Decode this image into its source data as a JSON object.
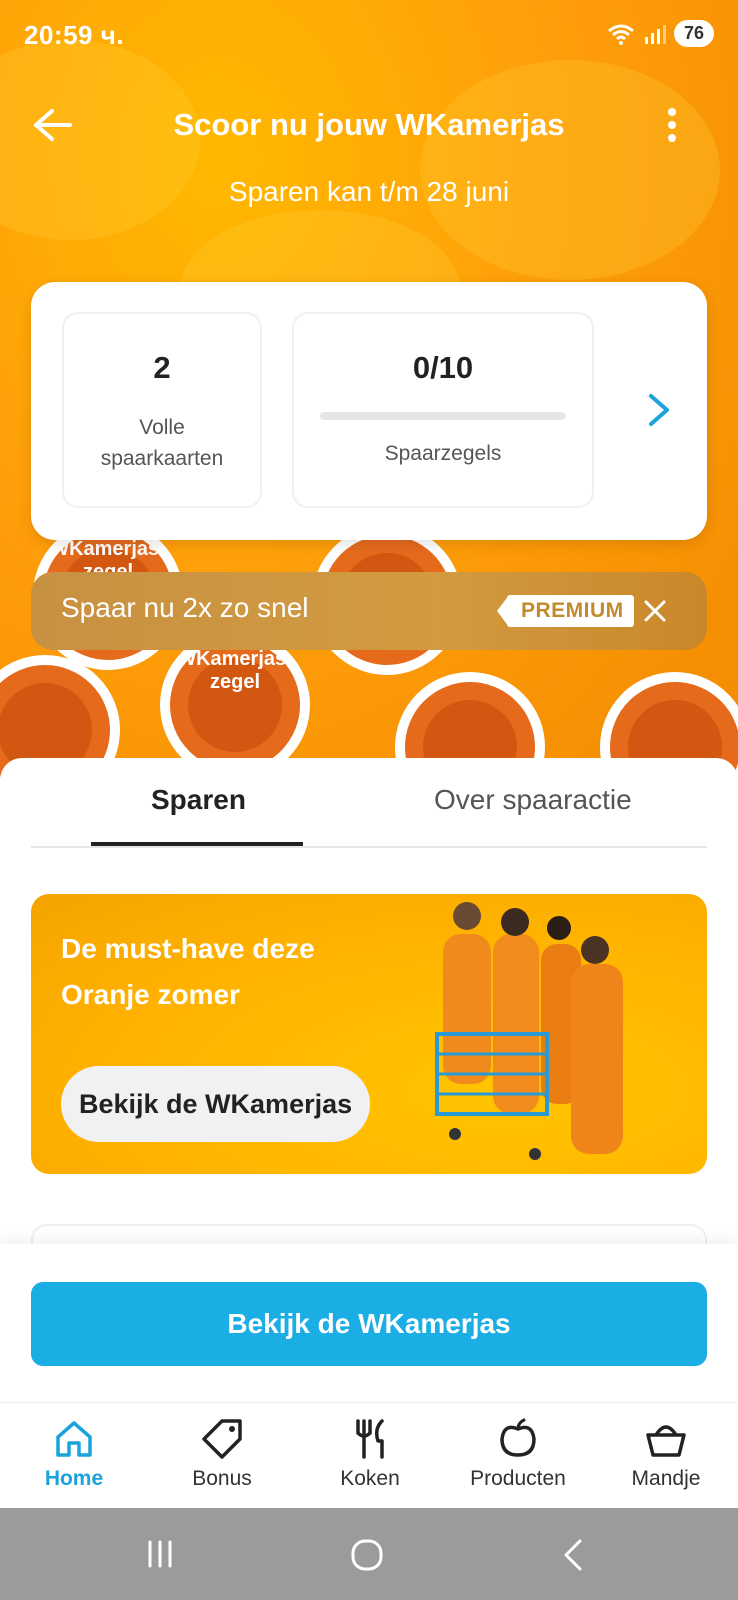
{
  "status_bar": {
    "time": "20:59 ч.",
    "battery": "76"
  },
  "header": {
    "title": "Scoor nu jouw WKamerjas",
    "subtitle": "Sparen kan t/m 28 juni"
  },
  "summary": {
    "full_cards_value": "2",
    "full_cards_label_1": "Volle",
    "full_cards_label_2": "spaarkaarten",
    "stamps_value": "0/10",
    "stamps_label": "Spaarzegels",
    "stamps_progress": 0
  },
  "stamp_art": {
    "text_a": "WKamerjas-zegel",
    "text_b": "WKamerjas-zegel"
  },
  "premium_banner": {
    "text": "Spaar nu 2x zo snel",
    "badge": "PREMIUM"
  },
  "tabs": [
    {
      "label": "Sparen",
      "active": true
    },
    {
      "label": "Over spaaractie",
      "active": false
    }
  ],
  "promo": {
    "title": "De must-have deze Oranje zomer",
    "button": "Bekijk de WKamerjas"
  },
  "cta": {
    "label": "Bekijk de WKamerjas"
  },
  "bottom_nav": [
    {
      "label": "Home",
      "icon": "home-icon",
      "active": true
    },
    {
      "label": "Bonus",
      "icon": "tag-icon",
      "active": false
    },
    {
      "label": "Koken",
      "icon": "cutlery-icon",
      "active": false
    },
    {
      "label": "Producten",
      "icon": "apple-icon",
      "active": false
    },
    {
      "label": "Mandje",
      "icon": "basket-icon",
      "active": false
    }
  ],
  "colors": {
    "accent": "#1aaee5",
    "orange": "#ff9f0a",
    "premium": "#c9903c"
  }
}
